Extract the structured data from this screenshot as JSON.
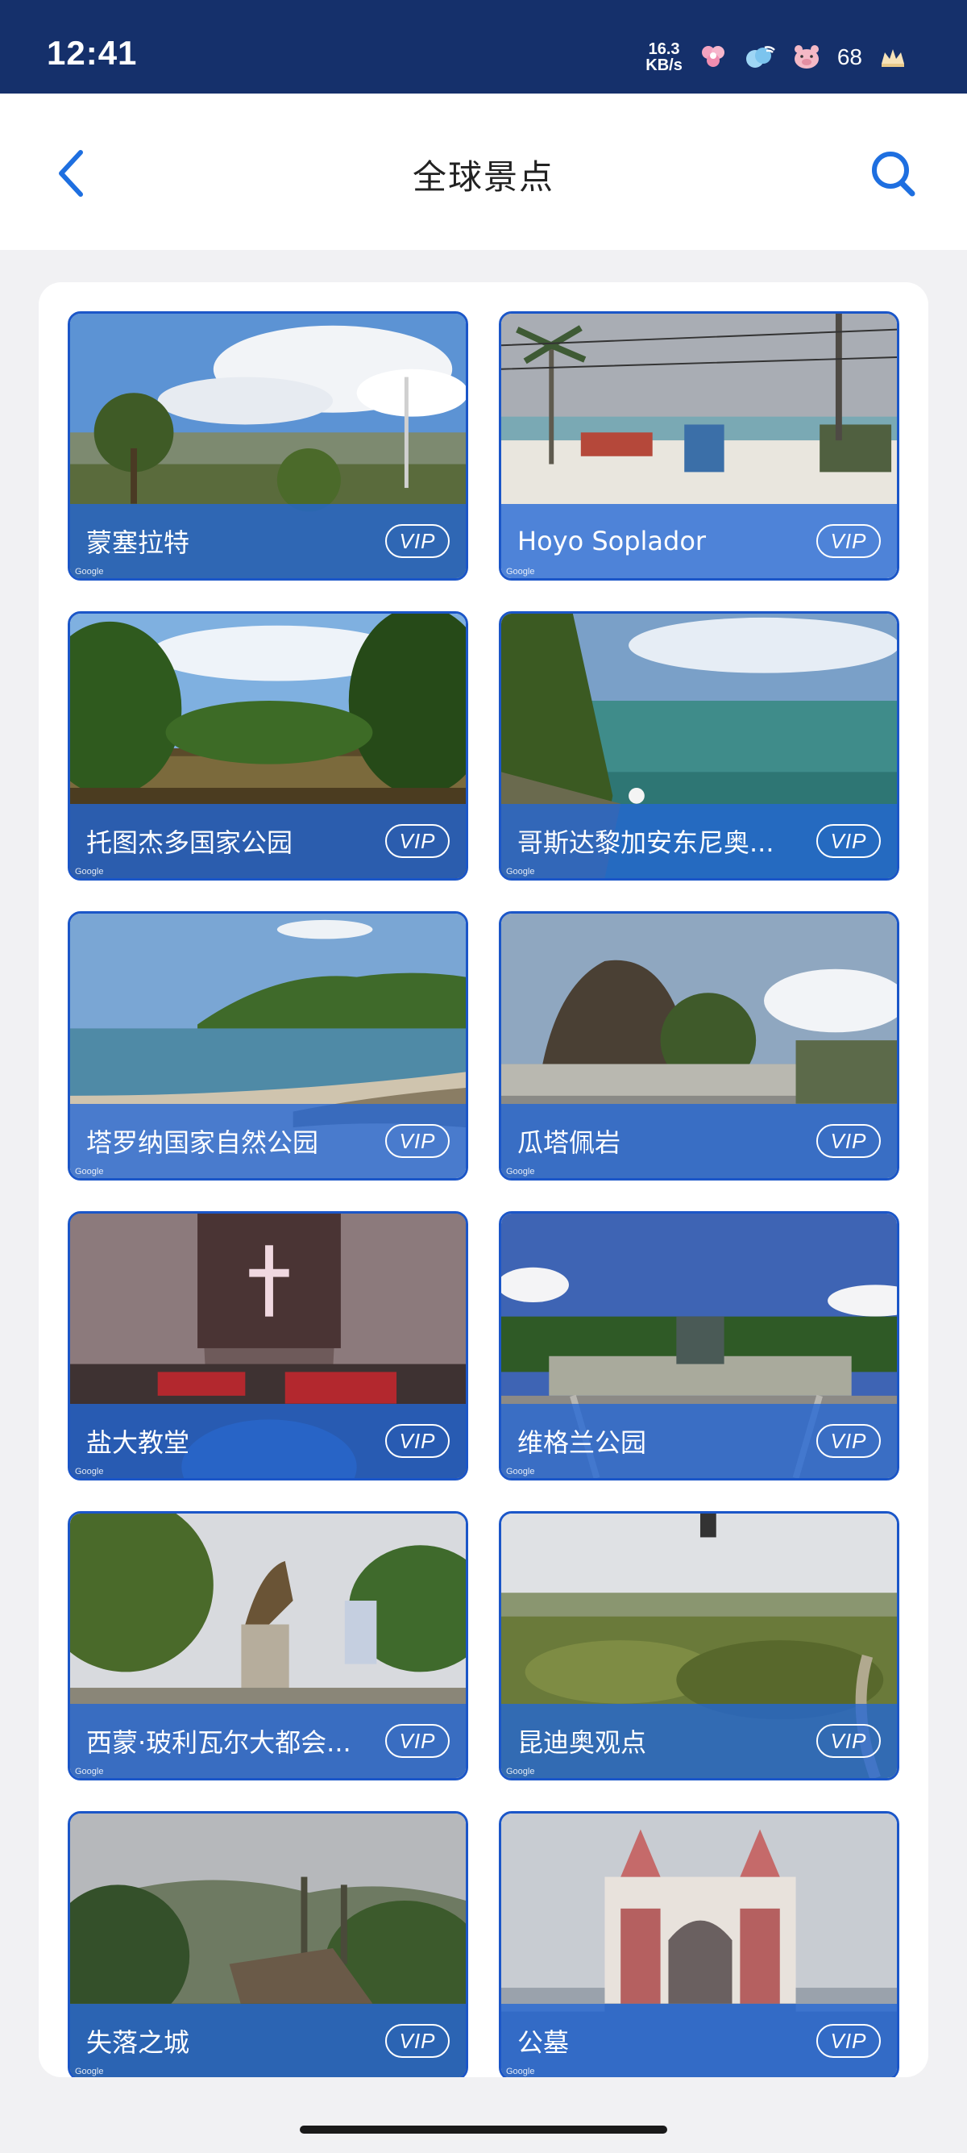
{
  "status_bar": {
    "time": "12:41",
    "net_speed_value": "16.3",
    "net_speed_unit": "KB/s",
    "battery": "68"
  },
  "nav": {
    "title": "全球景点",
    "back_icon": "chevron-left-icon",
    "search_icon": "search-icon"
  },
  "colors": {
    "status_bar": "#15306b",
    "accent": "#1b56c8",
    "card_overlay": "#2266d6"
  },
  "spots": [
    {
      "name": "蒙塞拉特",
      "badge": "VIP",
      "watermark": "Google"
    },
    {
      "name": "Hoyo Soplador",
      "badge": "VIP",
      "watermark": "Google"
    },
    {
      "name": "托图杰多国家公园",
      "badge": "VIP",
      "watermark": "Google"
    },
    {
      "name": "哥斯达黎加安东尼奥...",
      "badge": "VIP",
      "watermark": "Google"
    },
    {
      "name": "塔罗纳国家自然公园",
      "badge": "VIP",
      "watermark": "Google"
    },
    {
      "name": "瓜塔佩岩",
      "badge": "VIP",
      "watermark": "Google"
    },
    {
      "name": "盐大教堂",
      "badge": "VIP",
      "watermark": "Google"
    },
    {
      "name": "维格兰公园",
      "badge": "VIP",
      "watermark": "Google"
    },
    {
      "name": "西蒙·玻利瓦尔大都会...",
      "badge": "VIP",
      "watermark": "Google"
    },
    {
      "name": "昆迪奥观点",
      "badge": "VIP",
      "watermark": "Google"
    },
    {
      "name": "失落之城",
      "badge": "VIP",
      "watermark": "Google"
    },
    {
      "name": "公墓",
      "badge": "VIP",
      "watermark": "Google"
    }
  ]
}
